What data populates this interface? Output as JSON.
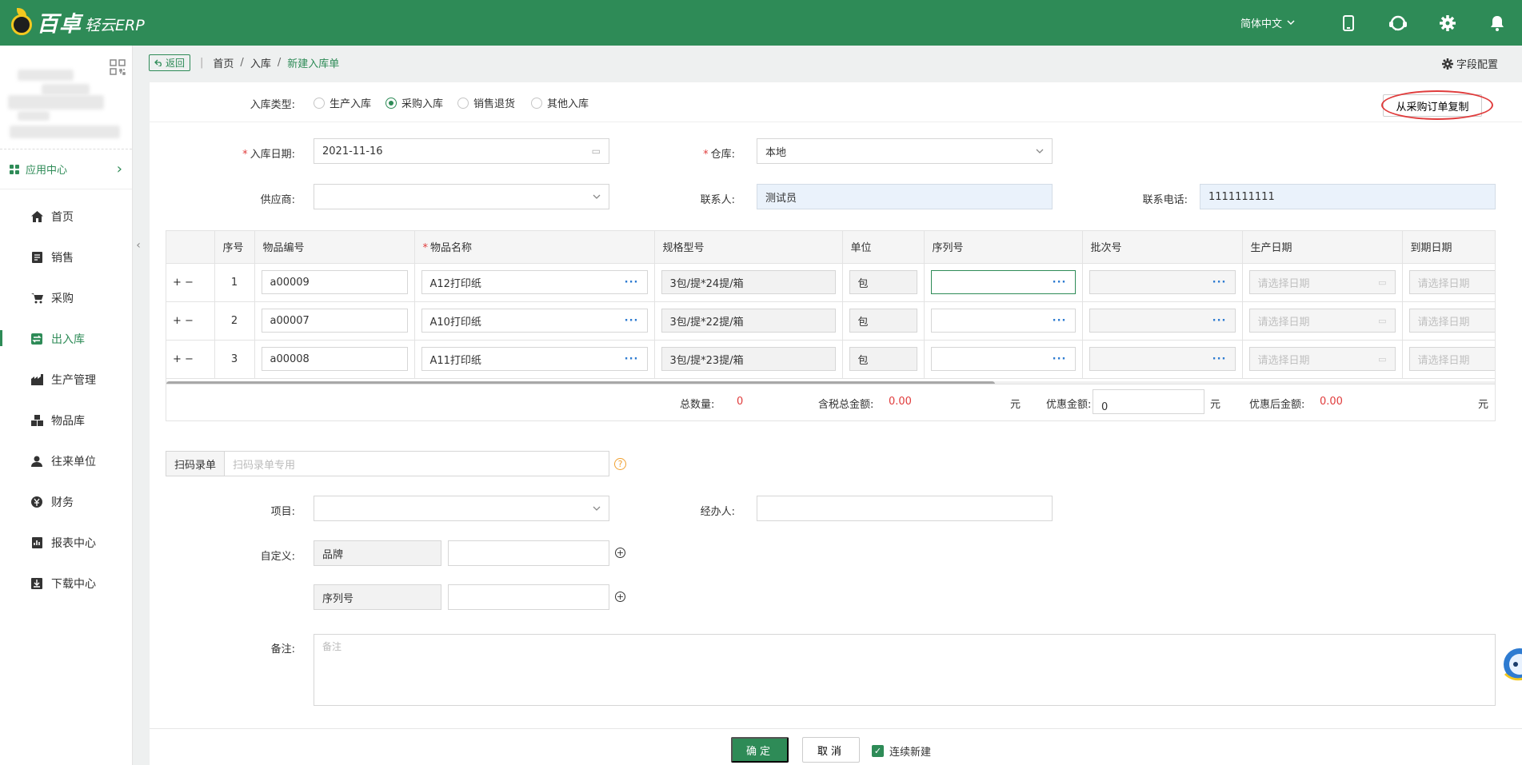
{
  "brand": {
    "name": "百卓",
    "product": "轻云ERP",
    "colors": {
      "primary": "#2e8b57",
      "required": "#e03c3c"
    }
  },
  "topbar": {
    "language": "简体中文",
    "icons": [
      "mobile-icon",
      "support-icon",
      "gear-icon",
      "bell-icon"
    ]
  },
  "sidebar": {
    "app_center": "应用中心",
    "items": [
      {
        "label": "首页",
        "icon": "home-icon"
      },
      {
        "label": "销售",
        "icon": "sales-icon"
      },
      {
        "label": "采购",
        "icon": "cart-icon"
      },
      {
        "label": "出入库",
        "icon": "exchange-icon",
        "active": true
      },
      {
        "label": "生产管理",
        "icon": "factory-icon"
      },
      {
        "label": "物品库",
        "icon": "boxes-icon"
      },
      {
        "label": "往来单位",
        "icon": "user-icon"
      },
      {
        "label": "财务",
        "icon": "finance-icon"
      },
      {
        "label": "报表中心",
        "icon": "report-icon"
      },
      {
        "label": "下载中心",
        "icon": "download-icon"
      }
    ]
  },
  "breadcrumb": {
    "back": "返回",
    "items": [
      "首页",
      "入库",
      "新建入库单"
    ]
  },
  "field_config": "字段配置",
  "form": {
    "type_label": "入库类型:",
    "types": [
      "生产入库",
      "采购入库",
      "销售退货",
      "其他入库"
    ],
    "selected_type": "采购入库",
    "copy_button": "从采购订单复制",
    "date_label": "入库日期:",
    "date_value": "2021-11-16",
    "warehouse_label": "仓库:",
    "warehouse_value": "本地",
    "supplier_label": "供应商:",
    "supplier_value": "",
    "contact_label": "联系人:",
    "contact_value": "测试员",
    "phone_label": "联系电话:",
    "phone_value": "1111111111"
  },
  "table": {
    "columns": [
      "",
      "序号",
      "物品编号",
      "物品名称",
      "规格型号",
      "单位",
      "序列号",
      "批次号",
      "生产日期",
      "到期日期"
    ],
    "required_column": "物品名称",
    "date_placeholder": "请选择日期",
    "rows": [
      {
        "index": "1",
        "code": "a00009",
        "name": "A12打印纸",
        "spec": "3包/提*24提/箱",
        "unit": "包"
      },
      {
        "index": "2",
        "code": "a00007",
        "name": "A10打印纸",
        "spec": "3包/提*22提/箱",
        "unit": "包"
      },
      {
        "index": "3",
        "code": "a00008",
        "name": "A11打印纸",
        "spec": "3包/提*23提/箱",
        "unit": "包"
      }
    ]
  },
  "summary": {
    "qty_label": "总数量:",
    "qty": "0",
    "total_label": "含税总金额:",
    "total": "0.00",
    "yuan": "元",
    "discount_label": "优惠金额:",
    "discount": "0",
    "after_label": "优惠后金额:",
    "after": "0.00"
  },
  "scan": {
    "label": "扫码录单",
    "placeholder": "扫码录单专用"
  },
  "extra": {
    "project_label": "项目:",
    "handler_label": "经办人:",
    "custom_label": "自定义:",
    "custom_fields": [
      "品牌",
      "序列号"
    ],
    "remark_label": "备注:",
    "remark_placeholder": "备注"
  },
  "footer": {
    "confirm": "确定",
    "cancel": "取消",
    "continue": "连续新建",
    "continue_checked": true
  }
}
